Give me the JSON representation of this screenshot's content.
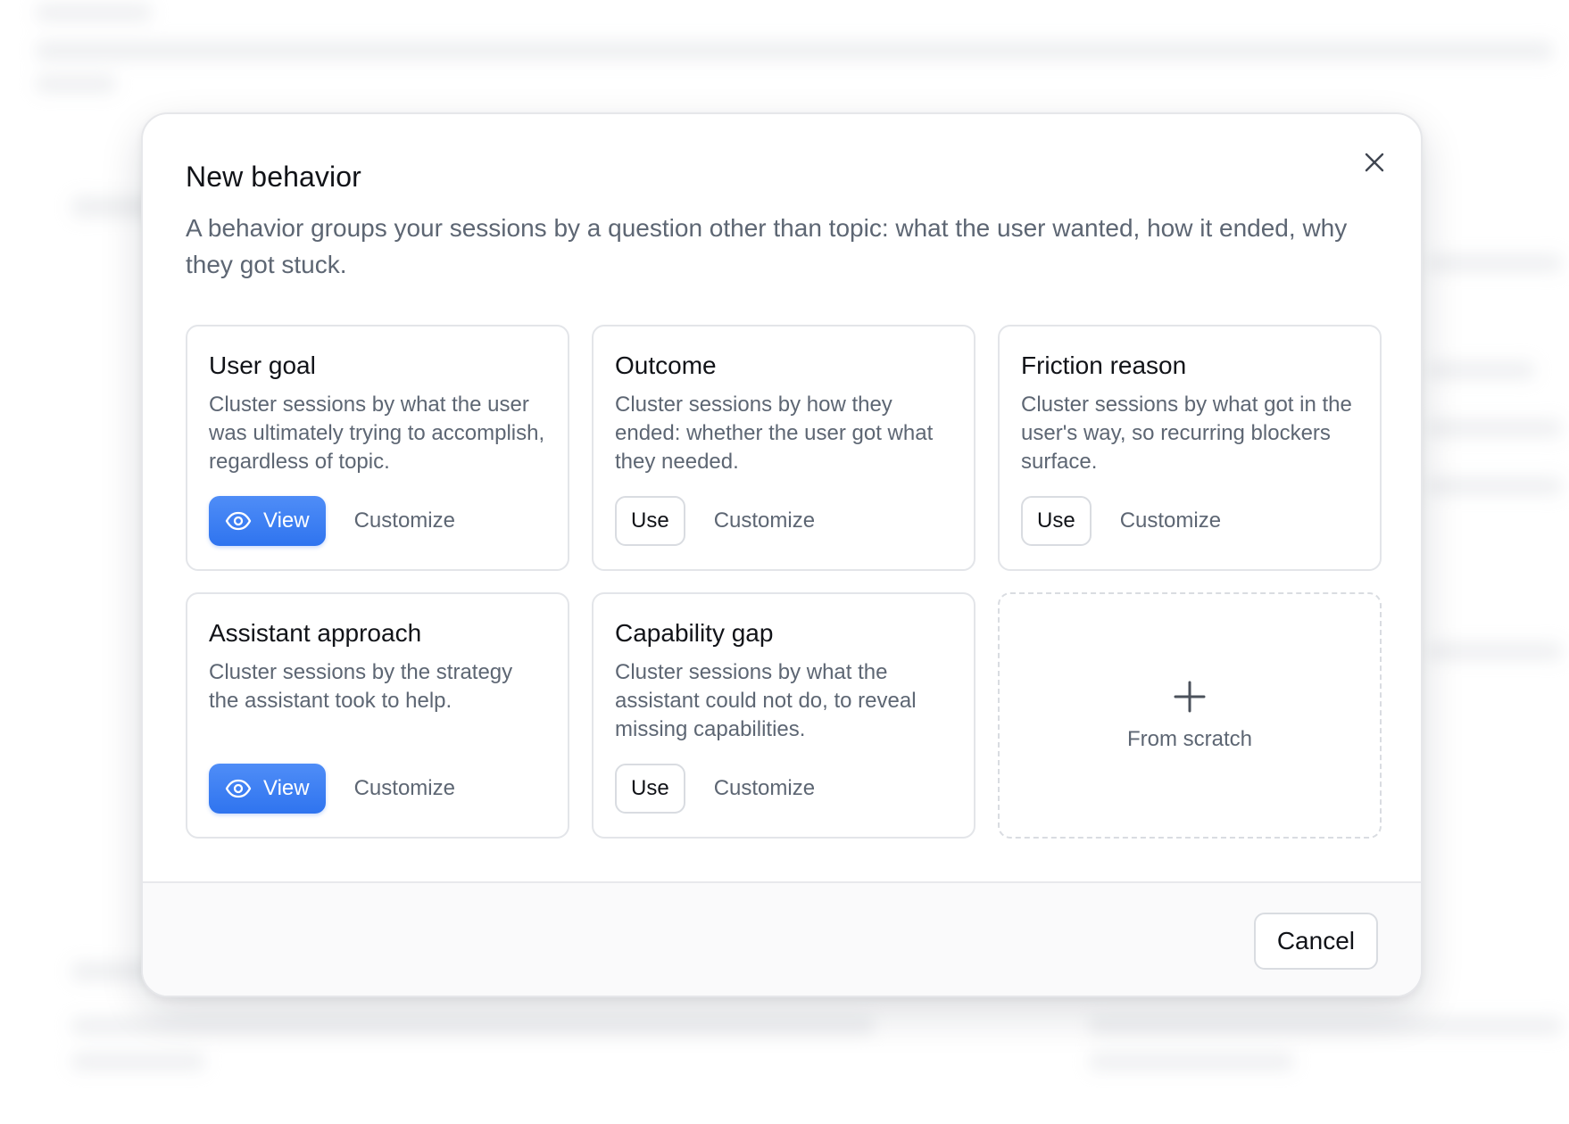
{
  "dialog": {
    "title": "New behavior",
    "subtitle": "A behavior groups your sessions by a question other than topic: what the user wanted, how it ended, why they got stuck."
  },
  "cards": [
    {
      "title": "User goal",
      "description": "Cluster sessions by what the user was ultimately trying to accomplish, regardless of topic.",
      "primary_action": "View",
      "primary_icon": "eye-icon",
      "secondary_action": "Customize"
    },
    {
      "title": "Outcome",
      "description": "Cluster sessions by how they ended: whether the user got what they needed.",
      "primary_action": "Use",
      "secondary_action": "Customize"
    },
    {
      "title": "Friction reason",
      "description": "Cluster sessions by what got in the user's way, so recurring blockers surface.",
      "primary_action": "Use",
      "secondary_action": "Customize"
    },
    {
      "title": "Assistant approach",
      "description": "Cluster sessions by the strategy the assistant took to help.",
      "primary_action": "View",
      "primary_icon": "eye-icon",
      "secondary_action": "Customize"
    },
    {
      "title": "Capability gap",
      "description": "Cluster sessions by what the assistant could not do, to reveal missing capabilities.",
      "primary_action": "Use",
      "secondary_action": "Customize"
    }
  ],
  "scratch": {
    "label": "From scratch",
    "icon": "plus-icon"
  },
  "footer": {
    "cancel_label": "Cancel"
  },
  "colors": {
    "accent": "#2f74ef",
    "text_primary": "#111318",
    "text_secondary": "#5d6673",
    "border": "#e3e5e9"
  }
}
